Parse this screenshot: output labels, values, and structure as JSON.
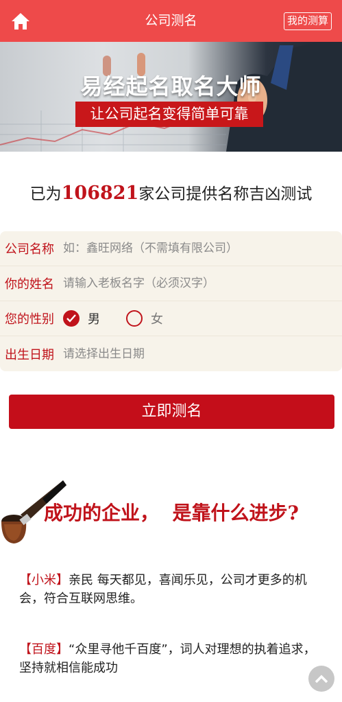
{
  "header": {
    "title": "公司测名",
    "home_icon": "home-icon",
    "my_button_label": "我的测算",
    "background_color": "#ee4a4a"
  },
  "banner": {
    "title": "易经起名取名大师",
    "subtitle": "让公司起名变得简单可靠"
  },
  "stats": {
    "prefix": "已为",
    "count": "106821",
    "suffix": "家公司提供名称吉凶测试"
  },
  "form": {
    "company_label": "公司名称",
    "company_placeholder": "如：鑫旺网络（不需填有限公司）",
    "name_label": "你的姓名",
    "name_placeholder": "请输入老板名字（必须汉字）",
    "gender_label": "您的性别",
    "gender_male": "男",
    "gender_female": "女",
    "gender_selected": "男",
    "birth_label": "出生日期",
    "birth_placeholder": "请选择出生日期"
  },
  "submit_label": "立即测名",
  "section": {
    "title_part1": "成功的企业，",
    "title_part2": "是靠什么进步?",
    "items": [
      {
        "tag": "【小米】",
        "text": "亲民 每天都见，喜闻乐见，公司才更多的机会，符合互联网思维。"
      },
      {
        "tag": "【百度】",
        "text": "“众里寻他千百度”，词人对理想的执着追求，坚持就相信能成功"
      }
    ]
  },
  "accent_color": "#c0131b"
}
